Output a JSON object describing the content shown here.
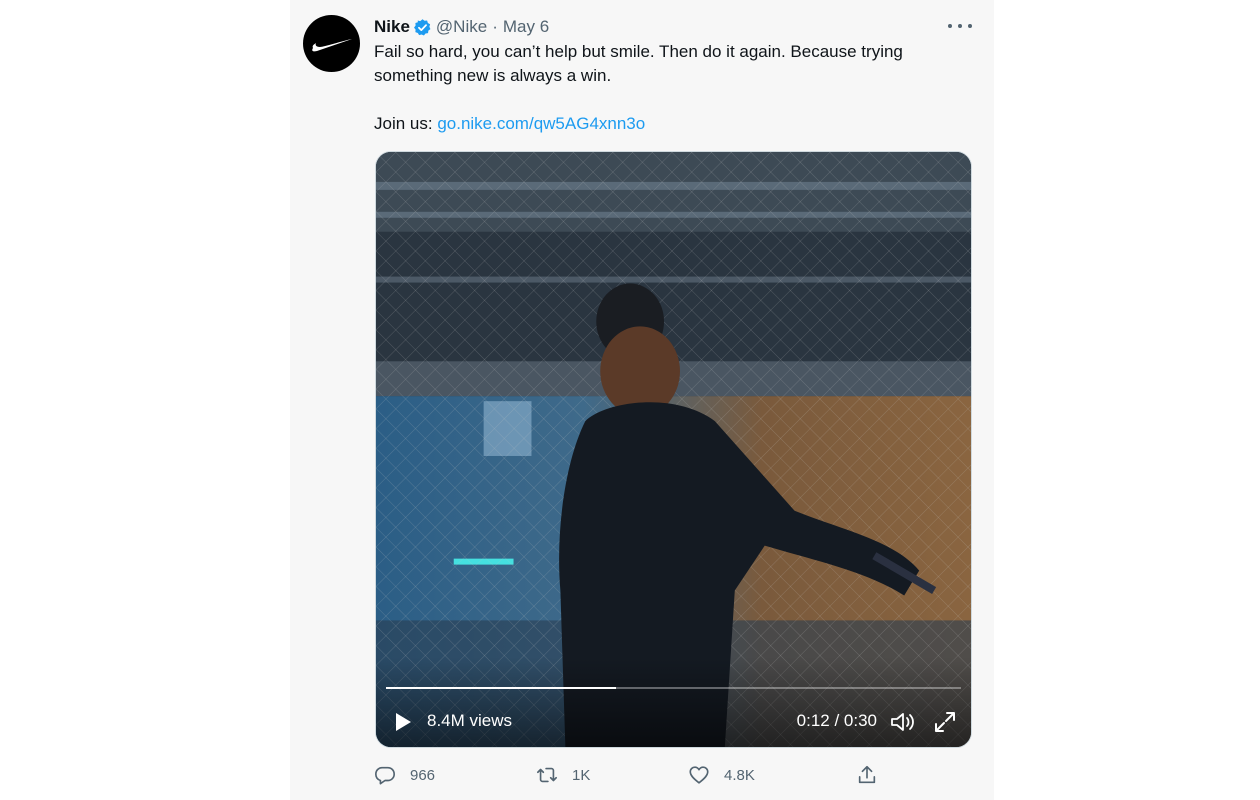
{
  "tweet": {
    "author_name": "Nike",
    "verified": true,
    "handle": "@Nike",
    "separator": "·",
    "date": "May 6",
    "text_line1": "Fail so hard, you can’t help but smile. Then do it again. Because trying something new is always a win.",
    "join_prefix": "Join us: ",
    "link_text": "go.nike.com/qw5AG4xnn3o"
  },
  "video": {
    "views": "8.4M views",
    "time": "0:12 / 0:30",
    "progress": 0.4
  },
  "actions": {
    "replies": "966",
    "retweets": "1K",
    "likes": "4.8K"
  },
  "colors": {
    "link": "#1d9bf0",
    "verified": "#1d9bf0",
    "muted": "#536471"
  },
  "icons": {
    "avatar": "nike-swoosh-icon",
    "verified": "verified-badge-icon",
    "more": "more-dots-icon",
    "play": "play-icon",
    "volume": "volume-icon",
    "fullscreen": "fullscreen-icon",
    "reply": "reply-icon",
    "retweet": "retweet-icon",
    "like": "heart-icon",
    "share": "share-icon"
  }
}
